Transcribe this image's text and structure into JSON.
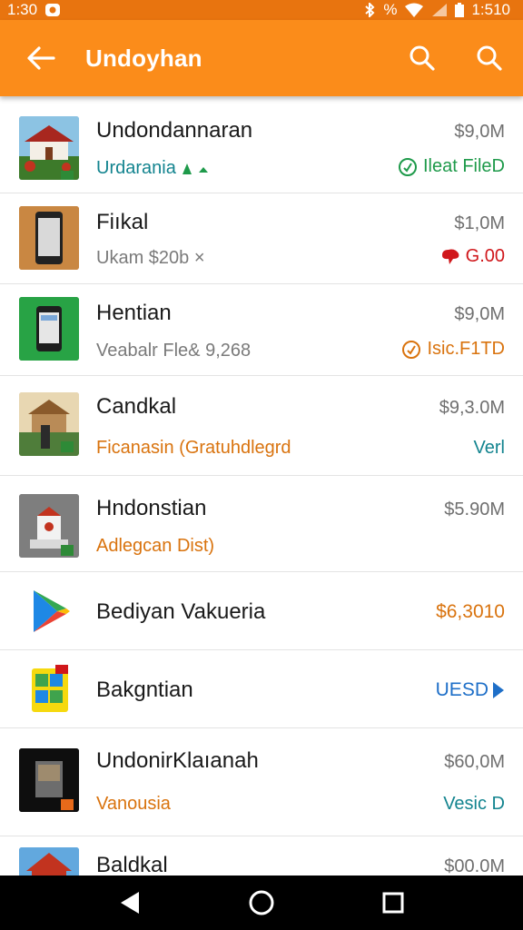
{
  "status_bar": {
    "time_left": "1:30",
    "time_right": "1:510",
    "percent": "%"
  },
  "app_bar": {
    "title": "Undoyhan"
  },
  "rows": [
    {
      "name": "Undondannaran",
      "subtitle": "Urdarania",
      "size": "$9,0M",
      "status": "Ileat FileD"
    },
    {
      "name": "Fiıkal",
      "subtitle": "Ukam $20b ×",
      "size": "$1,0M",
      "status": "G.00"
    },
    {
      "name": "Hentian",
      "subtitle": "Veabalr Fle& 9,268",
      "size": "$9,0M",
      "status": "Isic.F1TD"
    },
    {
      "name": "Candkal",
      "subtitle": "Ficanasin (Gratuhdlegrd",
      "size": "$9,3.0M",
      "status": "Verl"
    },
    {
      "name": "Hndonstian",
      "subtitle": "Adlegcan Dist)",
      "size": "$5.90M"
    },
    {
      "name": "Bediyan Vakueria",
      "value": "$6,3010"
    },
    {
      "name": "Bakgntian",
      "value": "UESD"
    },
    {
      "name": "UndonirKlaıanah",
      "subtitle": "Vanousia",
      "size": "$60,0M",
      "status": "Vesic D"
    },
    {
      "name": "Baldkal",
      "size": "$00.0M"
    }
  ],
  "colors": {
    "status_bar": "#e8740f",
    "app_bar": "#fb8c1a",
    "teal": "#13848f",
    "green": "#1e9a4a",
    "red": "#d0171b",
    "orange": "#d9730e",
    "blue": "#1e6fc8"
  },
  "icons": {
    "back": "arrow-left-icon",
    "search": "search-icon",
    "play_store": "play-store-icon",
    "nav_back": "triangle-back-icon",
    "nav_home": "circle-home-icon",
    "nav_recent": "square-recents-icon"
  }
}
